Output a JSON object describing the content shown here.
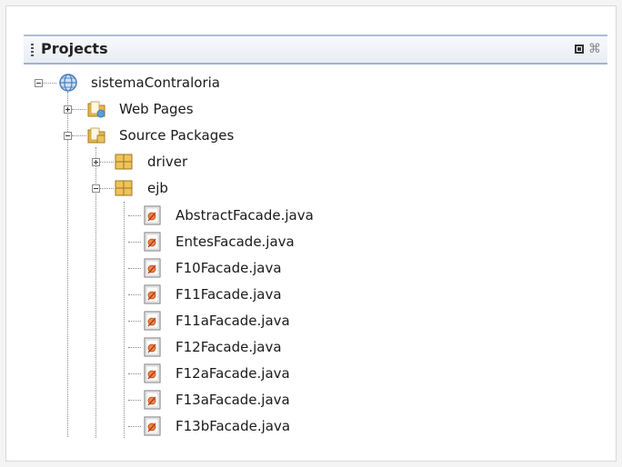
{
  "panel": {
    "title": "Projects",
    "minimize_icon": "minimize-icon",
    "close_glyph": "⌘"
  },
  "tree": {
    "project": {
      "label": "sistemaContraloria",
      "icon": "globe-project-icon",
      "expanded": true
    },
    "web_pages": {
      "label": "Web Pages",
      "icon": "web-folder-icon",
      "expanded": false
    },
    "source_packages": {
      "label": "Source Packages",
      "icon": "source-folder-icon",
      "expanded": true
    },
    "driver": {
      "label": "driver",
      "icon": "package-icon",
      "expanded": false
    },
    "ejb": {
      "label": "ejb",
      "icon": "package-icon",
      "expanded": true
    },
    "files": [
      {
        "label": "AbstractFacade.java",
        "icon": "java-class-icon"
      },
      {
        "label": "EntesFacade.java",
        "icon": "java-class-icon"
      },
      {
        "label": "F10Facade.java",
        "icon": "java-class-icon"
      },
      {
        "label": "F11Facade.java",
        "icon": "java-class-icon"
      },
      {
        "label": "F11aFacade.java",
        "icon": "java-class-icon"
      },
      {
        "label": "F12Facade.java",
        "icon": "java-class-icon"
      },
      {
        "label": "F12aFacade.java",
        "icon": "java-class-icon"
      },
      {
        "label": "F13aFacade.java",
        "icon": "java-class-icon"
      },
      {
        "label": "F13bFacade.java",
        "icon": "java-class-icon"
      }
    ]
  },
  "colors": {
    "header_border": "#9fb4cf",
    "folder": "#e8b84a",
    "package": "#d9a63a",
    "globe": "#4a7fc0"
  }
}
